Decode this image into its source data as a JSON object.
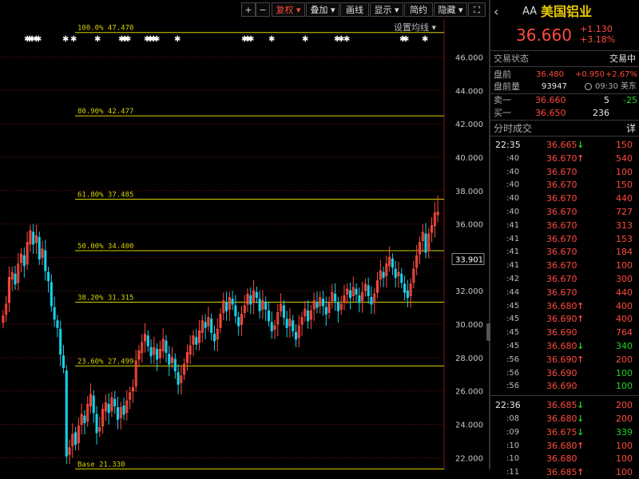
{
  "toolbar": {
    "plus": "+",
    "minus": "−",
    "adjust": "复权 ▾",
    "overlay": "叠加 ▾",
    "draw": "画线",
    "display": "显示 ▾",
    "compact": "简约",
    "hide": "隐藏 ▾",
    "fullscreen": "⛶"
  },
  "ma_setting": "设置均线 ▾",
  "chart_data": {
    "type": "candlestick",
    "y_range": [
      21.3,
      47.6
    ],
    "y_ticks": [
      {
        "v": 46,
        "label": "46.000"
      },
      {
        "v": 44,
        "label": "44.000"
      },
      {
        "v": 42,
        "label": "42.000"
      },
      {
        "v": 40,
        "label": "40.000"
      },
      {
        "v": 38,
        "label": "38.000"
      },
      {
        "v": 36,
        "label": "36.000"
      },
      {
        "v": 34,
        "label": "34.000"
      },
      {
        "v": 32,
        "label": "32.000"
      },
      {
        "v": 30,
        "label": "30.000"
      },
      {
        "v": 28,
        "label": "28.000"
      },
      {
        "v": 26,
        "label": "26.000"
      },
      {
        "v": 24,
        "label": "24.000"
      },
      {
        "v": 22,
        "label": "22.000"
      }
    ],
    "current_price": {
      "v": 33.901,
      "label": "33.901"
    },
    "fib_levels": [
      {
        "v": 47.47,
        "label": "100.0% 47.470"
      },
      {
        "v": 42.477,
        "label": "80.90% 42.477"
      },
      {
        "v": 37.485,
        "label": "61.80% 37.485"
      },
      {
        "v": 34.4,
        "label": "50.00% 34.400"
      },
      {
        "v": 31.315,
        "label": "38.20% 31.315"
      },
      {
        "v": 27.499,
        "label": "23.60% 27.499"
      },
      {
        "v": 21.33,
        "label": "Base 21.330"
      }
    ],
    "closes": [
      30.5,
      31.2,
      32.8,
      33.1,
      32.4,
      33.6,
      34.2,
      33.5,
      34.9,
      35.6,
      34.8,
      35.3,
      33.9,
      34.5,
      33.2,
      32.6,
      31.1,
      30.3,
      29.8,
      28.2,
      27.4,
      22.1,
      22.6,
      23.4,
      22.8,
      23.9,
      24.6,
      24.1,
      25.2,
      25.8,
      24.7,
      23.5,
      23.8,
      24.9,
      25.3,
      24.7,
      25.6,
      25.1,
      24.3,
      25.0,
      24.6,
      25.4,
      25.9,
      26.2,
      27.8,
      28.4,
      28.9,
      29.4,
      28.7,
      28.1,
      28.6,
      27.9,
      28.5,
      29.1,
      28.3,
      27.6,
      28.0,
      27.2,
      26.4,
      26.9,
      27.6,
      28.3,
      28.7,
      29.3,
      28.8,
      29.6,
      30.2,
      29.8,
      30.4,
      29.5,
      29.0,
      29.7,
      30.6,
      31.4,
      30.8,
      31.6,
      31.2,
      30.5,
      29.9,
      30.6,
      31.1,
      31.8,
      31.2,
      32.0,
      31.6,
      30.8,
      31.4,
      30.9,
      30.2,
      29.6,
      29.9,
      30.7,
      31.2,
      30.4,
      29.8,
      30.3,
      29.6,
      29.1,
      29.9,
      30.4,
      30.9,
      30.2,
      30.8,
      31.4,
      31.0,
      31.6,
      31.1,
      30.6,
      31.3,
      31.9,
      31.4,
      30.8,
      31.2,
      31.7,
      32.1,
      31.6,
      32.2,
      31.8,
      31.3,
      31.9,
      32.4,
      31.7,
      31.2,
      31.8,
      32.6,
      33.2,
      32.8,
      33.6,
      34.0,
      33.4,
      32.8,
      33.1,
      32.5,
      31.9,
      31.6,
      32.4,
      33.3,
      34.1,
      34.9,
      35.5,
      34.3,
      35.4,
      35.9,
      36.66
    ],
    "opens": [
      30.1,
      30.6,
      31.3,
      32.7,
      33.0,
      32.5,
      33.7,
      34.1,
      33.6,
      34.8,
      35.5,
      34.9,
      35.2,
      34.0,
      34.4,
      33.1,
      32.5,
      31.0,
      30.2,
      29.7,
      28.1,
      27.2,
      22.2,
      22.7,
      23.5,
      22.9,
      24.0,
      24.5,
      24.2,
      25.1,
      25.7,
      24.6,
      23.6,
      23.9,
      24.8,
      25.2,
      24.8,
      25.5,
      25.0,
      24.4,
      25.1,
      24.7,
      25.5,
      26.0,
      26.3,
      27.9,
      28.3,
      29.0,
      29.3,
      28.6,
      28.2,
      28.5,
      28.0,
      28.4,
      29.0,
      28.2,
      27.7,
      27.9,
      27.1,
      26.5,
      27.0,
      27.7,
      28.2,
      28.8,
      29.2,
      28.9,
      29.5,
      30.1,
      29.9,
      30.3,
      29.4,
      29.1,
      29.8,
      30.7,
      31.3,
      30.9,
      31.5,
      31.1,
      30.4,
      30.0,
      30.7,
      31.2,
      31.7,
      31.3,
      31.9,
      31.5,
      30.9,
      31.3,
      30.8,
      30.1,
      29.7,
      30.0,
      30.8,
      31.1,
      30.3,
      29.9,
      30.2,
      29.5,
      29.2,
      30.0,
      30.5,
      30.8,
      30.3,
      30.9,
      31.3,
      31.1,
      31.5,
      31.0,
      30.7,
      31.4,
      31.8,
      31.3,
      30.9,
      31.3,
      31.8,
      32.0,
      31.7,
      32.1,
      31.7,
      31.4,
      32.0,
      32.3,
      31.6,
      31.3,
      31.9,
      32.7,
      33.1,
      32.9,
      33.5,
      33.9,
      33.3,
      32.9,
      33.0,
      32.4,
      32.0,
      31.7,
      32.5,
      33.4,
      34.2,
      35.0,
      35.4,
      34.4,
      35.5,
      35.9
    ],
    "last_spike": {
      "open": 36.62,
      "high": 37.7,
      "low": 36.1,
      "close": 36.66
    },
    "event_star_x": [
      30,
      33,
      36,
      41,
      44,
      78,
      88,
      118,
      148,
      152,
      156,
      180,
      184,
      188,
      192,
      218,
      302,
      306,
      310,
      336,
      378,
      418,
      423,
      430,
      500,
      504,
      528
    ]
  },
  "panel": {
    "symbol": "AA",
    "name": "美国铝业",
    "price": "36.660",
    "change": "+1.130",
    "change_pct": "+3.18%",
    "status_label": "交易状态",
    "status_value": "交易中",
    "pre_label": "盘前",
    "pre_price": "36.480",
    "pre_change": "+0.950",
    "pre_pct": "+2.67%",
    "pre_vol_label": "盘前量",
    "pre_vol": "93947",
    "clock_icon": "clock-icon",
    "pre_time": "09:30 美东",
    "ask_label": "卖一",
    "ask_price": "36.660",
    "ask_vol": "5",
    "ask_diff": "-25",
    "bid_label": "买一",
    "bid_price": "36.650",
    "bid_vol": "236",
    "ticks_title": "分时成交",
    "ticks_detail": "详",
    "ticks": [
      {
        "t": "22:35",
        "p": "36.665",
        "d": "down",
        "v": "150",
        "vc": "red"
      },
      {
        "t": ":40",
        "p": "36.670",
        "d": "up",
        "v": "540",
        "vc": "red"
      },
      {
        "t": ":40",
        "p": "36.670",
        "d": "",
        "v": "100",
        "vc": "red"
      },
      {
        "t": ":40",
        "p": "36.670",
        "d": "",
        "v": "150",
        "vc": "red"
      },
      {
        "t": ":40",
        "p": "36.670",
        "d": "",
        "v": "440",
        "vc": "red"
      },
      {
        "t": ":40",
        "p": "36.670",
        "d": "",
        "v": "727",
        "vc": "red"
      },
      {
        "t": ":41",
        "p": "36.670",
        "d": "",
        "v": "313",
        "vc": "red"
      },
      {
        "t": ":41",
        "p": "36.670",
        "d": "",
        "v": "153",
        "vc": "red"
      },
      {
        "t": ":41",
        "p": "36.670",
        "d": "",
        "v": "184",
        "vc": "red"
      },
      {
        "t": ":41",
        "p": "36.670",
        "d": "",
        "v": "100",
        "vc": "red"
      },
      {
        "t": ":42",
        "p": "36.670",
        "d": "",
        "v": "300",
        "vc": "red"
      },
      {
        "t": ":44",
        "p": "36.670",
        "d": "",
        "v": "440",
        "vc": "red"
      },
      {
        "t": ":45",
        "p": "36.680",
        "d": "up",
        "v": "400",
        "vc": "red"
      },
      {
        "t": ":45",
        "p": "36.690",
        "d": "up",
        "v": "400",
        "vc": "red"
      },
      {
        "t": ":45",
        "p": "36.690",
        "d": "",
        "v": "764",
        "vc": "red"
      },
      {
        "t": ":45",
        "p": "36.680",
        "d": "down",
        "v": "340",
        "vc": "green"
      },
      {
        "t": ":56",
        "p": "36.690",
        "d": "up",
        "v": "200",
        "vc": "red"
      },
      {
        "t": ":56",
        "p": "36.690",
        "d": "",
        "v": "100",
        "vc": "green"
      },
      {
        "t": ":56",
        "p": "36.690",
        "d": "",
        "v": "100",
        "vc": "green"
      },
      {
        "t": "22:36",
        "p": "36.685",
        "d": "down",
        "v": "200",
        "vc": "red"
      },
      {
        "t": ":08",
        "p": "36.680",
        "d": "down",
        "v": "200",
        "vc": "red"
      },
      {
        "t": ":09",
        "p": "36.675",
        "d": "down",
        "v": "339",
        "vc": "green"
      },
      {
        "t": ":10",
        "p": "36.680",
        "d": "up",
        "v": "100",
        "vc": "red"
      },
      {
        "t": ":10",
        "p": "36.680",
        "d": "",
        "v": "100",
        "vc": "red"
      },
      {
        "t": ":11",
        "p": "36.685",
        "d": "up",
        "v": "100",
        "vc": "red"
      }
    ]
  },
  "colors": {
    "up": "#ff4b3e",
    "down": "#17d0e8",
    "fib": "#d8d000",
    "grid": "#8a1a1a",
    "star": "#ffffff"
  }
}
